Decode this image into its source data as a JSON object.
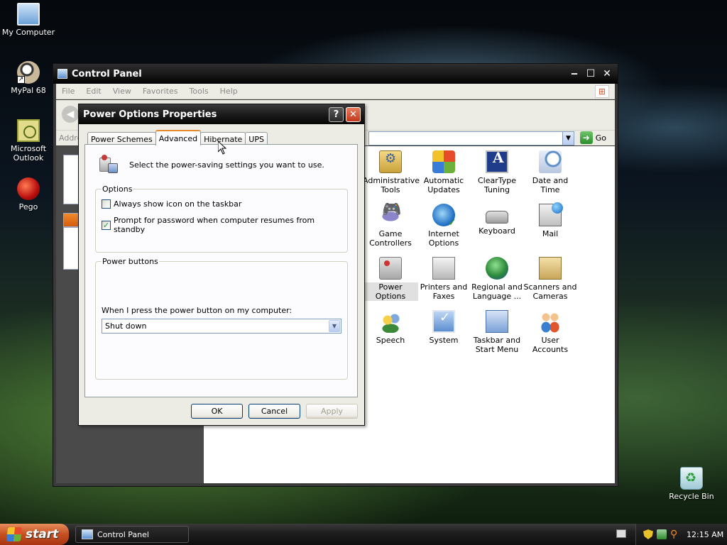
{
  "desktop": {
    "icons": [
      {
        "label": "My Computer",
        "icon": "my-computer-icon"
      },
      {
        "label": "MyPal 68",
        "icon": "mypal-icon"
      },
      {
        "label": "Microsoft Outlook",
        "icon": "outlook-icon"
      },
      {
        "label": "Pego",
        "icon": "pego-icon"
      },
      {
        "label": "Recycle Bin",
        "icon": "recycle-bin-icon"
      }
    ]
  },
  "control_panel": {
    "title": "Control Panel",
    "menu": [
      "File",
      "Edit",
      "View",
      "Favorites",
      "Tools",
      "Help"
    ],
    "address_label": "Addre",
    "go_label": "Go",
    "items": [
      {
        "label": "Administrative Tools",
        "icon": "administrative-tools-icon"
      },
      {
        "label": "Automatic Updates",
        "icon": "automatic-updates-icon"
      },
      {
        "label": "ClearType Tuning",
        "icon": "cleartype-tuning-icon"
      },
      {
        "label": "Date and Time",
        "icon": "date-time-icon"
      },
      {
        "label": "Game Controllers",
        "icon": "game-controllers-icon"
      },
      {
        "label": "Internet Options",
        "icon": "internet-options-icon"
      },
      {
        "label": "Keyboard",
        "icon": "keyboard-icon"
      },
      {
        "label": "Mail",
        "icon": "mail-icon"
      },
      {
        "label": "Power Options",
        "icon": "power-options-icon"
      },
      {
        "label": "Printers and Faxes",
        "icon": "printers-faxes-icon"
      },
      {
        "label": "Regional and Language ...",
        "icon": "regional-language-icon"
      },
      {
        "label": "Scanners and Cameras",
        "icon": "scanners-cameras-icon"
      },
      {
        "label": "Speech",
        "icon": "speech-icon"
      },
      {
        "label": "System",
        "icon": "system-icon"
      },
      {
        "label": "Taskbar and Start Menu",
        "icon": "taskbar-start-menu-icon"
      },
      {
        "label": "User Accounts",
        "icon": "user-accounts-icon"
      }
    ],
    "selected_item": "Power Options"
  },
  "dialog": {
    "title": "Power Options Properties",
    "help_label": "?",
    "close_label": "✕",
    "tabs": [
      "Power Schemes",
      "Advanced",
      "Hibernate",
      "UPS"
    ],
    "active_tab": "Advanced",
    "intro": "Select the power-saving settings you want to use.",
    "options_group": {
      "legend": "Options",
      "checkboxes": [
        {
          "label": "Always show icon on the taskbar",
          "checked": false
        },
        {
          "label": "Prompt for password when computer resumes from standby",
          "checked": true
        }
      ]
    },
    "power_buttons_group": {
      "legend": "Power buttons",
      "select_label": "When I press the power button on my computer:",
      "select_value": "Shut down"
    },
    "buttons": {
      "ok": "OK",
      "cancel": "Cancel",
      "apply": "Apply"
    }
  },
  "taskbar": {
    "start_label": "start",
    "task_label": "Control Panel",
    "clock": "12:15 AM"
  }
}
